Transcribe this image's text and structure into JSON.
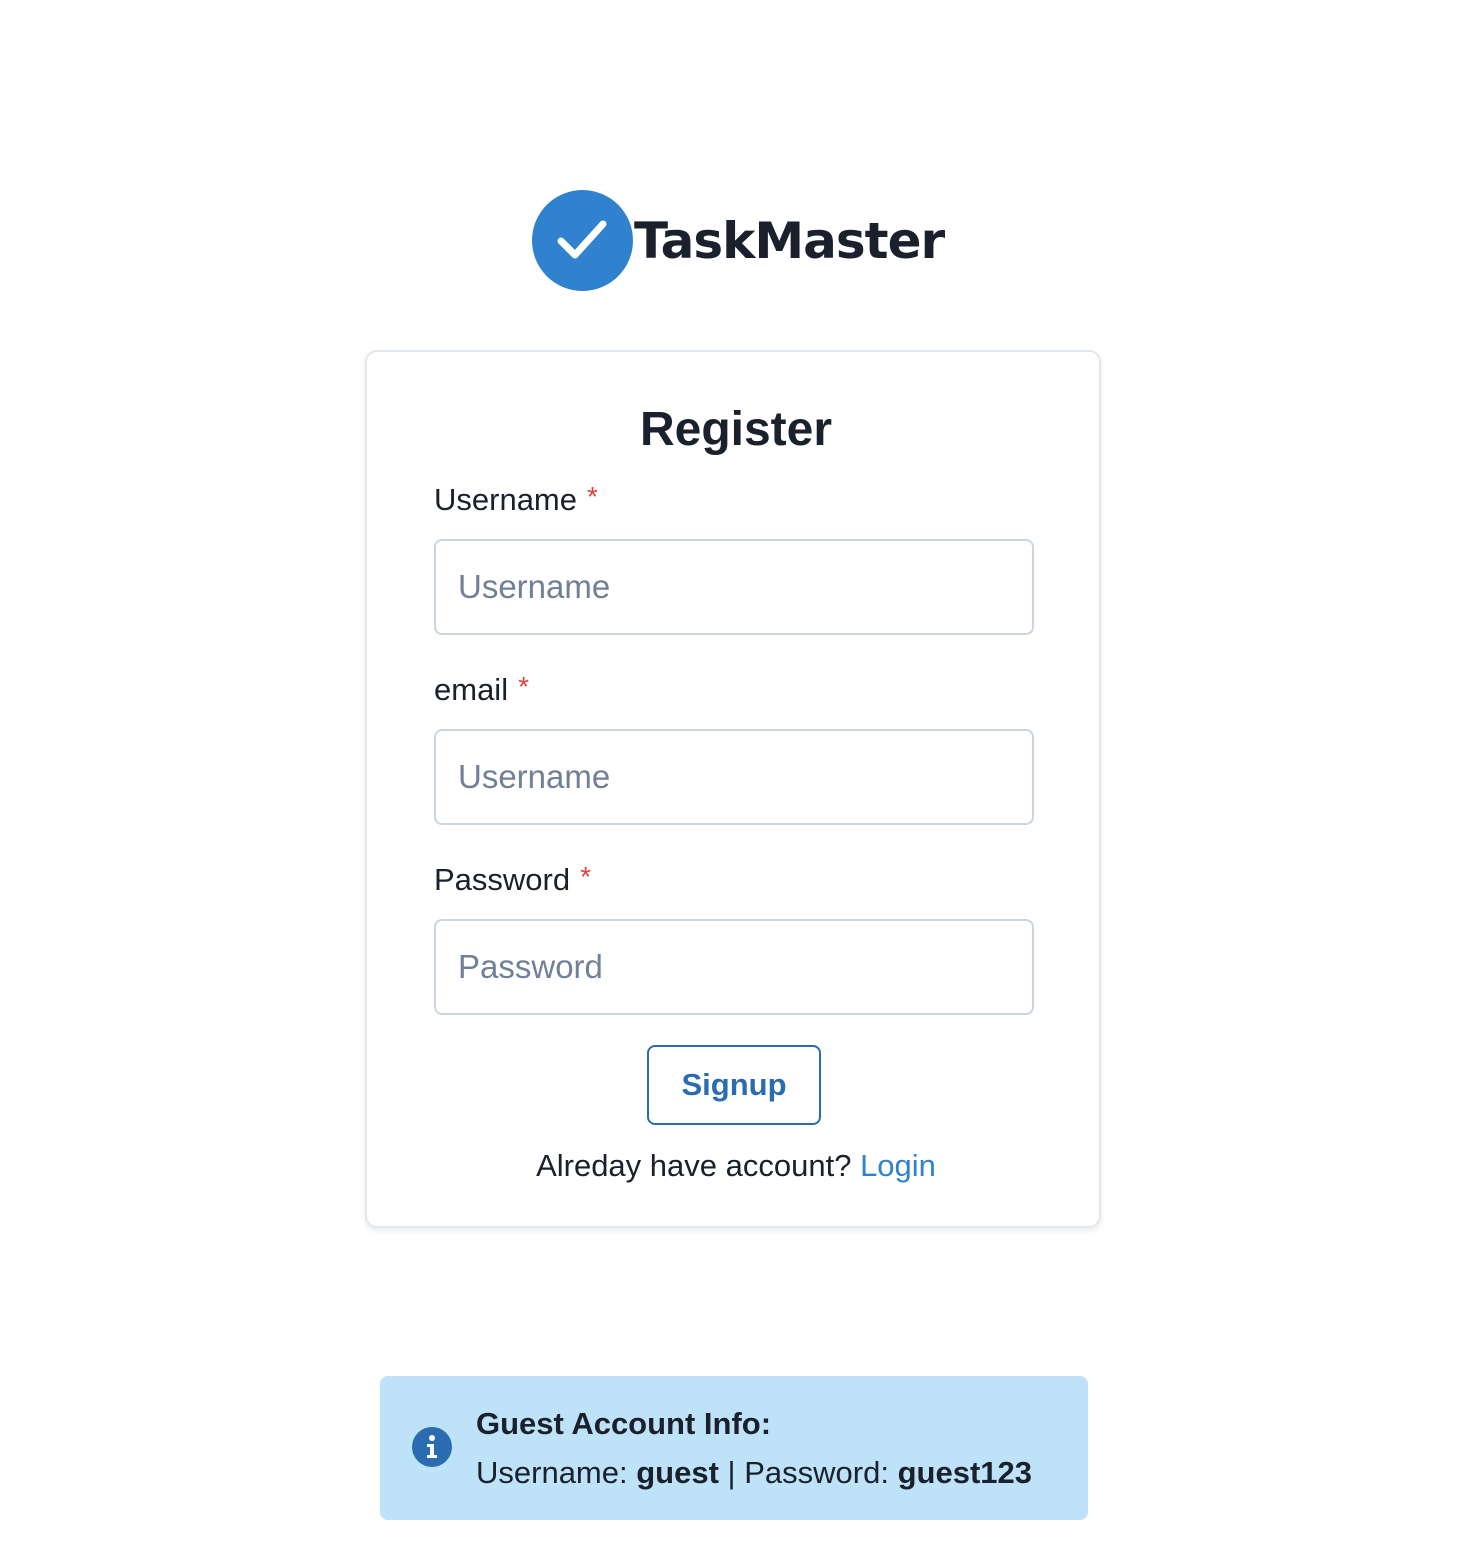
{
  "brand": {
    "name": "TaskMaster",
    "logo_icon": "check-circle-icon",
    "color": "#3182ce"
  },
  "form": {
    "title": "Register",
    "fields": [
      {
        "label": "Username",
        "required_mark": "*",
        "placeholder": "Username",
        "value": ""
      },
      {
        "label": "email",
        "required_mark": "*",
        "placeholder": "Username",
        "value": ""
      },
      {
        "label": "Password",
        "required_mark": "*",
        "placeholder": "Password",
        "value": ""
      }
    ],
    "submit_label": "Signup",
    "login_prompt": "Alreday have account?",
    "login_link": "Login"
  },
  "guest_info": {
    "icon": "info-icon",
    "title": "Guest Account Info:",
    "username_label": "Username:",
    "username_value": "guest",
    "separator": "|",
    "password_label": "Password:",
    "password_value": "guest123"
  },
  "colors": {
    "accent": "#3182ce",
    "button": "#2b6cb0",
    "required": "#e53e3e",
    "alert_bg": "#bee3f8"
  }
}
